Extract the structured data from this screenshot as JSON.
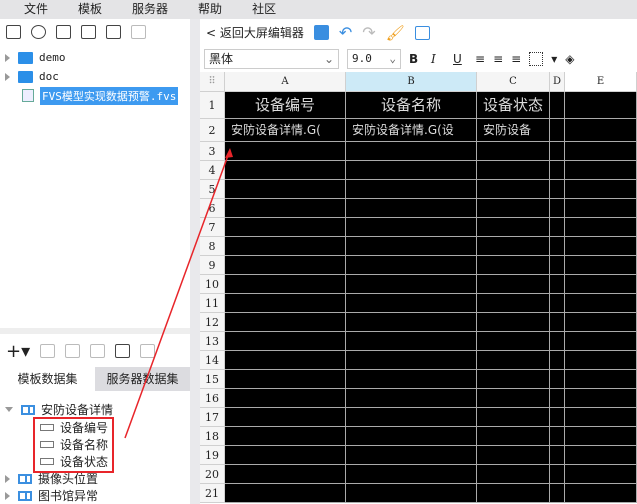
{
  "menu": [
    "文件",
    "模板",
    "服务器",
    "帮助",
    "社区"
  ],
  "file_tree": [
    {
      "name": "demo",
      "type": "folder"
    },
    {
      "name": "doc",
      "type": "folder"
    },
    {
      "name": "FVS模型实现数据预警.fvs",
      "type": "file",
      "selected": true
    }
  ],
  "toolbar": {
    "back_label": "返回大屏编辑器",
    "font": "黑体",
    "font_size": "9.0",
    "bold": "B",
    "italic": "I",
    "underline": "U"
  },
  "dataset_tabs": [
    "模板数据集",
    "服务器数据集"
  ],
  "datasets": [
    {
      "name": "安防设备详情",
      "expanded": true,
      "fields": [
        "设备编号",
        "设备名称",
        "设备状态"
      ]
    },
    {
      "name": "摄像头位置"
    },
    {
      "name": "图书馆异常"
    }
  ],
  "columns": [
    "A",
    "B",
    "C",
    "D",
    "E"
  ],
  "rows": [
    "1",
    "2",
    "3",
    "4",
    "5",
    "6",
    "7",
    "8",
    "9",
    "10",
    "11",
    "12",
    "13",
    "14",
    "15",
    "16",
    "17",
    "18",
    "19",
    "20",
    "21"
  ],
  "cells": {
    "r1": [
      "设备编号",
      "设备名称",
      "设备状态"
    ],
    "r2": [
      "安防设备详情.G(",
      "安防设备详情.G(设",
      "安防设备"
    ]
  },
  "colors": {
    "accent": "#3d9af0",
    "highlight": "#e8252a",
    "cell_bg": "#000000"
  }
}
